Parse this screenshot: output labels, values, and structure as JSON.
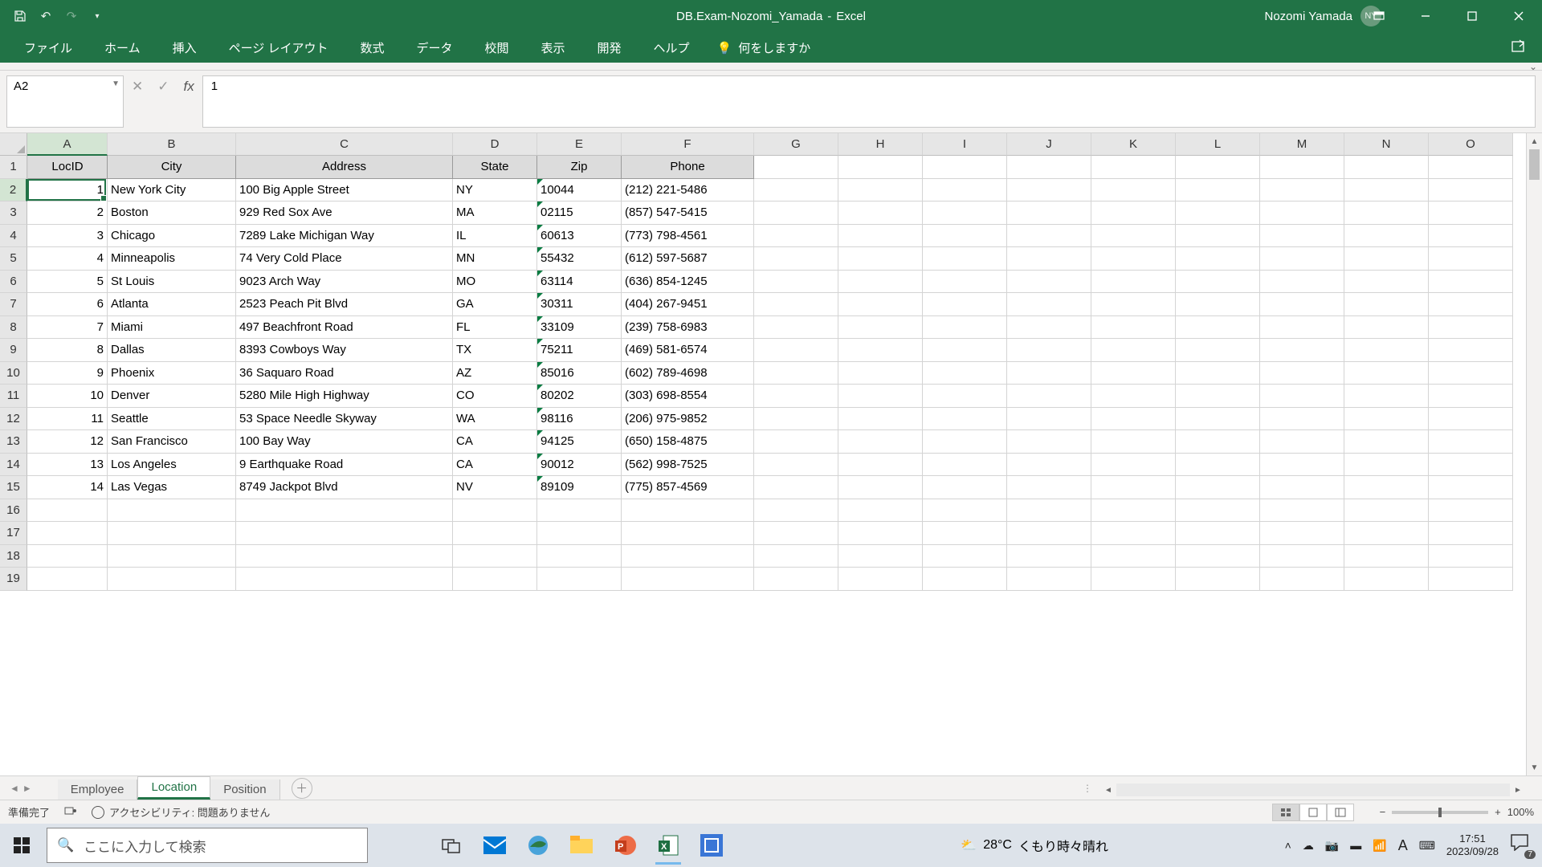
{
  "title": {
    "doc": "DB.Exam-Nozomi_Yamada",
    "app": "Excel"
  },
  "user": {
    "name": "Nozomi Yamada",
    "initials": "NY"
  },
  "ribbon": {
    "tabs": [
      "ファイル",
      "ホーム",
      "挿入",
      "ページ レイアウト",
      "数式",
      "データ",
      "校閲",
      "表示",
      "開発",
      "ヘルプ"
    ],
    "tellme_placeholder": "何をしますか"
  },
  "namebox": "A2",
  "formula": "1",
  "columns": [
    "A",
    "B",
    "C",
    "D",
    "E",
    "F",
    "G",
    "H",
    "I",
    "J",
    "K",
    "L",
    "M",
    "N",
    "O"
  ],
  "col_widths": [
    "cA",
    "cB",
    "cC",
    "cD",
    "cE",
    "cF",
    "cG",
    "cH",
    "cI",
    "cJ",
    "cK",
    "cL",
    "cM",
    "cN",
    "cO"
  ],
  "headers": [
    "LocID",
    "City",
    "Address",
    "State",
    "Zip",
    "Phone"
  ],
  "rows": [
    {
      "LocID": 1,
      "City": "New York City",
      "Address": "100 Big Apple Street",
      "State": "NY",
      "Zip": "10044",
      "Phone": "(212) 221-5486"
    },
    {
      "LocID": 2,
      "City": "Boston",
      "Address": "929 Red Sox Ave",
      "State": "MA",
      "Zip": "02115",
      "Phone": "(857) 547-5415"
    },
    {
      "LocID": 3,
      "City": "Chicago",
      "Address": "7289 Lake Michigan Way",
      "State": "IL",
      "Zip": "60613",
      "Phone": "(773) 798-4561"
    },
    {
      "LocID": 4,
      "City": "Minneapolis",
      "Address": "74 Very Cold Place",
      "State": "MN",
      "Zip": "55432",
      "Phone": "(612) 597-5687"
    },
    {
      "LocID": 5,
      "City": "St Louis",
      "Address": "9023 Arch Way",
      "State": "MO",
      "Zip": "63114",
      "Phone": "(636) 854-1245"
    },
    {
      "LocID": 6,
      "City": "Atlanta",
      "Address": "2523 Peach Pit Blvd",
      "State": "GA",
      "Zip": "30311",
      "Phone": "(404) 267-9451"
    },
    {
      "LocID": 7,
      "City": "Miami",
      "Address": "497 Beachfront Road",
      "State": "FL",
      "Zip": "33109",
      "Phone": "(239) 758-6983"
    },
    {
      "LocID": 8,
      "City": "Dallas",
      "Address": "8393 Cowboys Way",
      "State": "TX",
      "Zip": "75211",
      "Phone": "(469) 581-6574"
    },
    {
      "LocID": 9,
      "City": "Phoenix",
      "Address": "36 Saquaro Road",
      "State": "AZ",
      "Zip": "85016",
      "Phone": "(602) 789-4698"
    },
    {
      "LocID": 10,
      "City": "Denver",
      "Address": "5280 Mile High Highway",
      "State": "CO",
      "Zip": "80202",
      "Phone": "(303) 698-8554"
    },
    {
      "LocID": 11,
      "City": "Seattle",
      "Address": "53 Space Needle Skyway",
      "State": "WA",
      "Zip": "98116",
      "Phone": "(206) 975-9852"
    },
    {
      "LocID": 12,
      "City": "San Francisco",
      "Address": "100 Bay Way",
      "State": "CA",
      "Zip": "94125",
      "Phone": "(650) 158-4875"
    },
    {
      "LocID": 13,
      "City": "Los Angeles",
      "Address": "9 Earthquake Road",
      "State": "CA",
      "Zip": "90012",
      "Phone": "(562) 998-7525"
    },
    {
      "LocID": 14,
      "City": "Las Vegas",
      "Address": "8749 Jackpot Blvd",
      "State": "NV",
      "Zip": "89109",
      "Phone": "(775) 857-4569"
    }
  ],
  "visible_row_count": 19,
  "sheet_tabs": [
    "Employee",
    "Location",
    "Position"
  ],
  "active_sheet": 1,
  "status": {
    "ready": "準備完了",
    "accessibility": "アクセシビリティ: 問題ありません",
    "zoom": "100%"
  },
  "taskbar": {
    "search_placeholder": "ここに入力して検索",
    "weather": {
      "temp": "28°C",
      "text": "くもり時々晴れ"
    },
    "time": "17:51",
    "date": "2023/09/28",
    "notif_count": "7"
  },
  "active_cell": "A2"
}
